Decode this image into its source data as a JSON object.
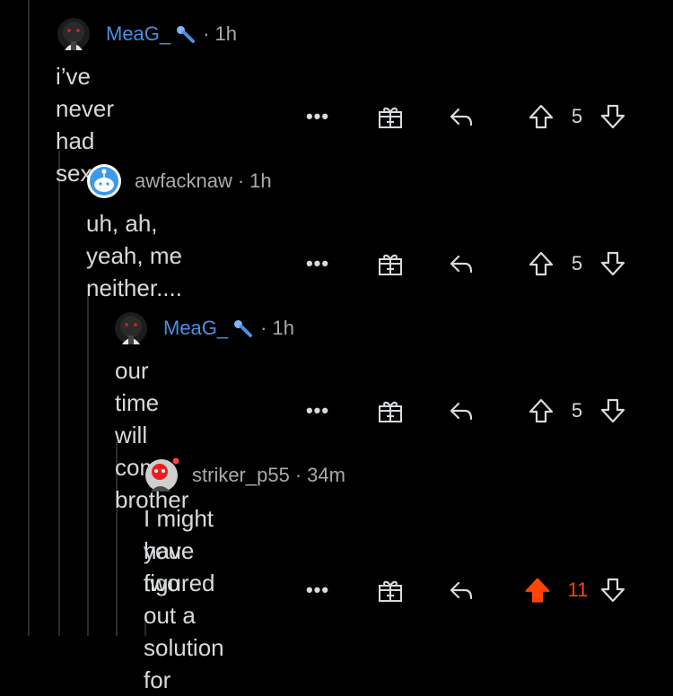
{
  "comments": [
    {
      "username": "MeaG_",
      "username_color": "#4a90e2",
      "has_flair": true,
      "flair_icon": "microphone-icon",
      "time": "1h",
      "separator": "·",
      "body": "i’ve never had sex",
      "more": "•••",
      "score": "5",
      "upvoted": false
    },
    {
      "username": "awfacknaw",
      "username_color": "#a8aaab",
      "has_flair": false,
      "time": "1h",
      "separator": "·",
      "body": "uh, ah, yeah, me neither....",
      "more": "•••",
      "score": "5",
      "upvoted": false
    },
    {
      "username": "MeaG_",
      "username_color": "#4a90e2",
      "has_flair": true,
      "flair_icon": "microphone-icon",
      "time": "1h",
      "separator": "·",
      "body": "our time will come brother",
      "more": "•••",
      "score": "5",
      "upvoted": false
    },
    {
      "username": "striker_p55",
      "username_color": "#a8aaab",
      "has_flair": false,
      "time": "34m",
      "separator": "·",
      "body_line1": "I might have figured out a solution for",
      "body_line2": "you two",
      "more": "•••",
      "score": "11",
      "upvoted": true
    }
  ],
  "colors": {
    "background": "#000000",
    "text": "#d7dadc",
    "muted": "#a8aaab",
    "accent_blue": "#4a90e2",
    "upvote_orange": "#ff4500",
    "thread_line": "#2b2b2b"
  }
}
